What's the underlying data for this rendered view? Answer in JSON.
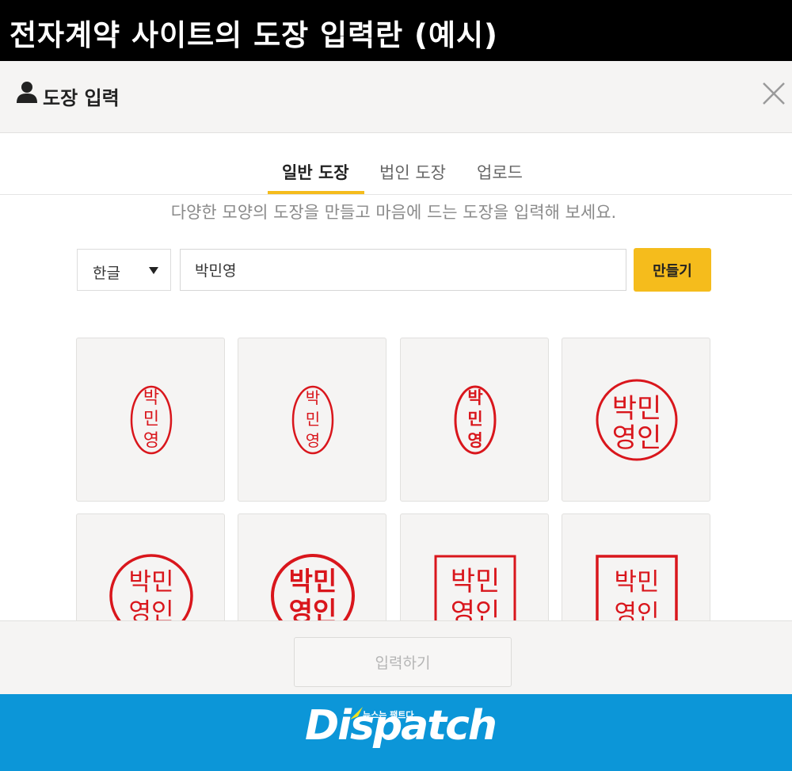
{
  "caption": "전자계약 사이트의 도장 입력란 (예시)",
  "modal": {
    "title": "도장 입력",
    "icons": {
      "person": "person-icon",
      "close": "close-icon"
    }
  },
  "tabs": [
    {
      "label": "일반 도장",
      "active": true
    },
    {
      "label": "법인 도장",
      "active": false
    },
    {
      "label": "업로드",
      "active": false
    }
  ],
  "description": "다양한 모양의 도장을 만들고 마음에 드는 도장을 입력해 보세요.",
  "form": {
    "language": "한글",
    "name_value": "박민영",
    "make_button": "만들기"
  },
  "stamps": [
    {
      "style": "oval-thin-vertical",
      "lines": [
        "박",
        "민",
        "영"
      ]
    },
    {
      "style": "oval-regular-vertical",
      "lines": [
        "박",
        "민",
        "영"
      ]
    },
    {
      "style": "oval-bold-vertical",
      "lines": [
        "박",
        "민",
        "영"
      ]
    },
    {
      "style": "circle-thin",
      "lines": [
        "박민",
        "영인"
      ]
    },
    {
      "style": "circle-regular",
      "lines": [
        "박민",
        "영인"
      ]
    },
    {
      "style": "circle-bold",
      "lines": [
        "박민",
        "영인"
      ]
    },
    {
      "style": "square-thin",
      "lines": [
        "박민",
        "영인"
      ]
    },
    {
      "style": "square-regular",
      "lines": [
        "박민",
        "영인"
      ]
    }
  ],
  "footer": {
    "submit_button": "입력하기"
  },
  "brand": {
    "logo": "Dispatch",
    "tagline": "뉴스는 팩트다"
  },
  "colors": {
    "accent": "#f5bc1c",
    "stamp_red": "#d9161c",
    "brand_blue": "#0c96d8",
    "caption_bg": "#000000"
  }
}
